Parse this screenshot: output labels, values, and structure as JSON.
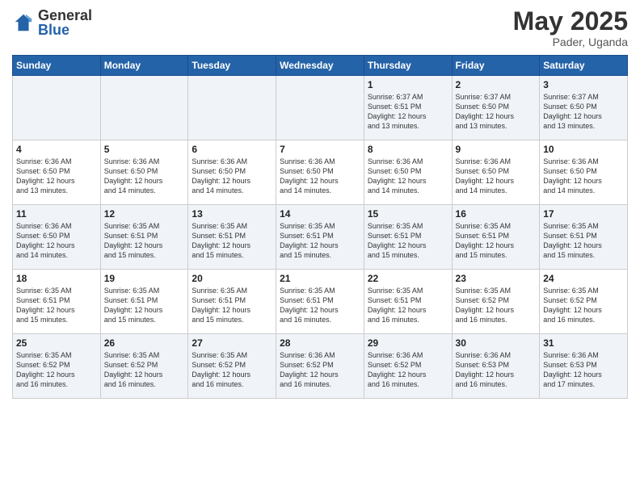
{
  "header": {
    "logo_general": "General",
    "logo_blue": "Blue",
    "month_title": "May 2025",
    "location": "Pader, Uganda"
  },
  "weekdays": [
    "Sunday",
    "Monday",
    "Tuesday",
    "Wednesday",
    "Thursday",
    "Friday",
    "Saturday"
  ],
  "weeks": [
    [
      {
        "day": "",
        "info": ""
      },
      {
        "day": "",
        "info": ""
      },
      {
        "day": "",
        "info": ""
      },
      {
        "day": "",
        "info": ""
      },
      {
        "day": "1",
        "info": "Sunrise: 6:37 AM\nSunset: 6:51 PM\nDaylight: 12 hours\nand 13 minutes."
      },
      {
        "day": "2",
        "info": "Sunrise: 6:37 AM\nSunset: 6:50 PM\nDaylight: 12 hours\nand 13 minutes."
      },
      {
        "day": "3",
        "info": "Sunrise: 6:37 AM\nSunset: 6:50 PM\nDaylight: 12 hours\nand 13 minutes."
      }
    ],
    [
      {
        "day": "4",
        "info": "Sunrise: 6:36 AM\nSunset: 6:50 PM\nDaylight: 12 hours\nand 13 minutes."
      },
      {
        "day": "5",
        "info": "Sunrise: 6:36 AM\nSunset: 6:50 PM\nDaylight: 12 hours\nand 14 minutes."
      },
      {
        "day": "6",
        "info": "Sunrise: 6:36 AM\nSunset: 6:50 PM\nDaylight: 12 hours\nand 14 minutes."
      },
      {
        "day": "7",
        "info": "Sunrise: 6:36 AM\nSunset: 6:50 PM\nDaylight: 12 hours\nand 14 minutes."
      },
      {
        "day": "8",
        "info": "Sunrise: 6:36 AM\nSunset: 6:50 PM\nDaylight: 12 hours\nand 14 minutes."
      },
      {
        "day": "9",
        "info": "Sunrise: 6:36 AM\nSunset: 6:50 PM\nDaylight: 12 hours\nand 14 minutes."
      },
      {
        "day": "10",
        "info": "Sunrise: 6:36 AM\nSunset: 6:50 PM\nDaylight: 12 hours\nand 14 minutes."
      }
    ],
    [
      {
        "day": "11",
        "info": "Sunrise: 6:36 AM\nSunset: 6:50 PM\nDaylight: 12 hours\nand 14 minutes."
      },
      {
        "day": "12",
        "info": "Sunrise: 6:35 AM\nSunset: 6:51 PM\nDaylight: 12 hours\nand 15 minutes."
      },
      {
        "day": "13",
        "info": "Sunrise: 6:35 AM\nSunset: 6:51 PM\nDaylight: 12 hours\nand 15 minutes."
      },
      {
        "day": "14",
        "info": "Sunrise: 6:35 AM\nSunset: 6:51 PM\nDaylight: 12 hours\nand 15 minutes."
      },
      {
        "day": "15",
        "info": "Sunrise: 6:35 AM\nSunset: 6:51 PM\nDaylight: 12 hours\nand 15 minutes."
      },
      {
        "day": "16",
        "info": "Sunrise: 6:35 AM\nSunset: 6:51 PM\nDaylight: 12 hours\nand 15 minutes."
      },
      {
        "day": "17",
        "info": "Sunrise: 6:35 AM\nSunset: 6:51 PM\nDaylight: 12 hours\nand 15 minutes."
      }
    ],
    [
      {
        "day": "18",
        "info": "Sunrise: 6:35 AM\nSunset: 6:51 PM\nDaylight: 12 hours\nand 15 minutes."
      },
      {
        "day": "19",
        "info": "Sunrise: 6:35 AM\nSunset: 6:51 PM\nDaylight: 12 hours\nand 15 minutes."
      },
      {
        "day": "20",
        "info": "Sunrise: 6:35 AM\nSunset: 6:51 PM\nDaylight: 12 hours\nand 15 minutes."
      },
      {
        "day": "21",
        "info": "Sunrise: 6:35 AM\nSunset: 6:51 PM\nDaylight: 12 hours\nand 16 minutes."
      },
      {
        "day": "22",
        "info": "Sunrise: 6:35 AM\nSunset: 6:51 PM\nDaylight: 12 hours\nand 16 minutes."
      },
      {
        "day": "23",
        "info": "Sunrise: 6:35 AM\nSunset: 6:52 PM\nDaylight: 12 hours\nand 16 minutes."
      },
      {
        "day": "24",
        "info": "Sunrise: 6:35 AM\nSunset: 6:52 PM\nDaylight: 12 hours\nand 16 minutes."
      }
    ],
    [
      {
        "day": "25",
        "info": "Sunrise: 6:35 AM\nSunset: 6:52 PM\nDaylight: 12 hours\nand 16 minutes."
      },
      {
        "day": "26",
        "info": "Sunrise: 6:35 AM\nSunset: 6:52 PM\nDaylight: 12 hours\nand 16 minutes."
      },
      {
        "day": "27",
        "info": "Sunrise: 6:35 AM\nSunset: 6:52 PM\nDaylight: 12 hours\nand 16 minutes."
      },
      {
        "day": "28",
        "info": "Sunrise: 6:36 AM\nSunset: 6:52 PM\nDaylight: 12 hours\nand 16 minutes."
      },
      {
        "day": "29",
        "info": "Sunrise: 6:36 AM\nSunset: 6:52 PM\nDaylight: 12 hours\nand 16 minutes."
      },
      {
        "day": "30",
        "info": "Sunrise: 6:36 AM\nSunset: 6:53 PM\nDaylight: 12 hours\nand 16 minutes."
      },
      {
        "day": "31",
        "info": "Sunrise: 6:36 AM\nSunset: 6:53 PM\nDaylight: 12 hours\nand 17 minutes."
      }
    ]
  ]
}
